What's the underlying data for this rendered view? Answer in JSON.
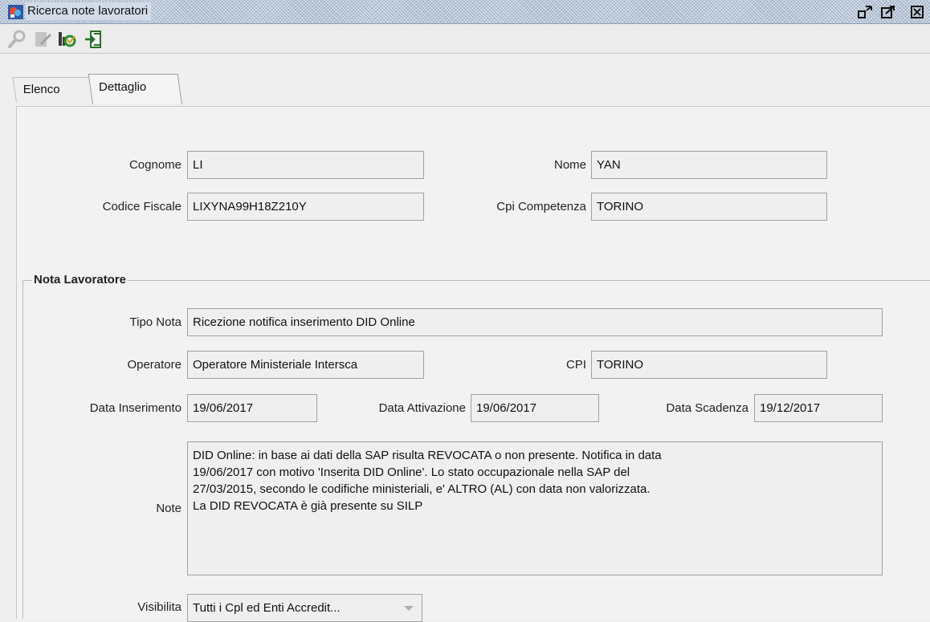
{
  "window": {
    "title": "Ricerca note lavoratori"
  },
  "toolbar": {
    "icons": [
      "search-icon",
      "edit-icon",
      "info-icon",
      "exit-icon"
    ]
  },
  "tabs": [
    {
      "label": "Elenco",
      "active": false
    },
    {
      "label": "Dettaglio",
      "active": true
    }
  ],
  "worker": {
    "cognome_label": "Cognome",
    "cognome": "LI",
    "nome_label": "Nome",
    "nome": "YAN",
    "codice_fiscale_label": "Codice Fiscale",
    "codice_fiscale": "LIXYNA99H18Z210Y",
    "cpi_competenza_label": "Cpi Competenza",
    "cpi_competenza": "TORINO"
  },
  "nota": {
    "group_title": "Nota Lavoratore",
    "tipo_nota_label": "Tipo Nota",
    "tipo_nota": "Ricezione notifica inserimento DID Online",
    "operatore_label": "Operatore",
    "operatore": "Operatore Ministeriale Intersca",
    "cpi_label": "CPI",
    "cpi": "TORINO",
    "data_inserimento_label": "Data Inserimento",
    "data_inserimento": "19/06/2017",
    "data_attivazione_label": "Data Attivazione",
    "data_attivazione": "19/06/2017",
    "data_scadenza_label": "Data Scadenza",
    "data_scadenza": "19/12/2017",
    "note_label": "Note",
    "note_lines": [
      "DID Online: in base ai dati della SAP risulta REVOCATA o non presente. Notifica in data",
      "19/06/2017 con motivo 'Inserita DID Online'. Lo stato occupazionale nella SAP del",
      "27/03/2015, secondo le codifiche ministeriali, e' ALTRO (AL) con data non valorizzata.",
      "La DID REVOCATA è già presente su SILP"
    ],
    "visibilita_label": "Visibilita",
    "visibilita": "Tutti i Cpl ed Enti Accredit..."
  },
  "colors": {
    "titlebar": "#b9c7d9",
    "panel": "#f2f2f2",
    "field_border": "#9ea1a4"
  }
}
